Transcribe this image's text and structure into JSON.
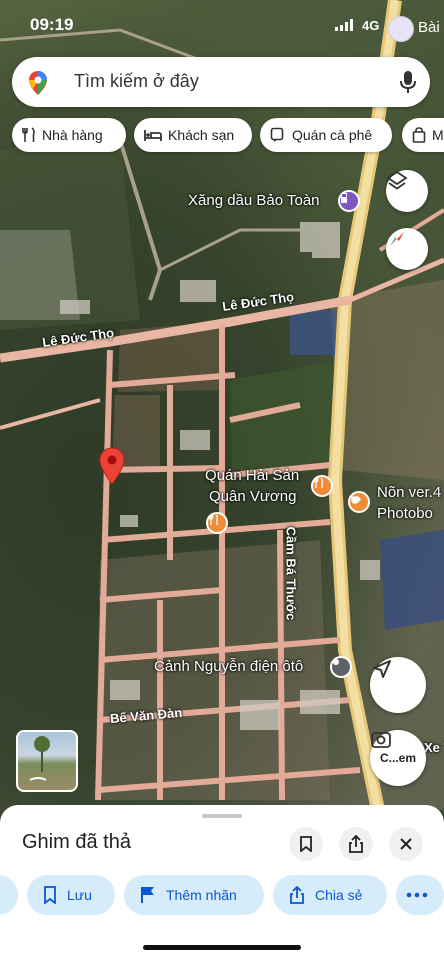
{
  "status": {
    "time": "09:19",
    "network": "4G",
    "account_label": "Bài"
  },
  "search": {
    "placeholder": "Tìm kiếm ở đây"
  },
  "chips": [
    {
      "label": "Nhà hàng"
    },
    {
      "label": "Khách sạn"
    },
    {
      "label": "Quán cà phê"
    },
    {
      "label": "M"
    }
  ],
  "map": {
    "places": {
      "gas_station": "Xăng dầu Bảo Toàn",
      "seafood_line1": "Quán Hải Sản",
      "seafood_line2": "Quân Vương",
      "cafe_line1": "Nõn ver.4",
      "cafe_line2": "Photobo",
      "garage": "Cảnh Nguyễn điện ôtô"
    },
    "roads": {
      "le_duc_tho_1": "Lê Đức Thọ",
      "le_duc_tho_2": "Lê Đức Thọ",
      "cam_ba_thuoc": "Cầm Bá Thước",
      "be_van_dan": "Bế Văn Đàn",
      "edge": "Xe T"
    },
    "lens_label": "C...em"
  },
  "sheet": {
    "title": "Ghim đã thả",
    "actions": [
      {
        "label": "Lưu"
      },
      {
        "label": "Thêm nhãn"
      },
      {
        "label": "Chia sẻ"
      }
    ]
  },
  "colors": {
    "accent": "#0b57d0",
    "chip_bg": "#d7ecfb",
    "pin": "#ea4335"
  }
}
